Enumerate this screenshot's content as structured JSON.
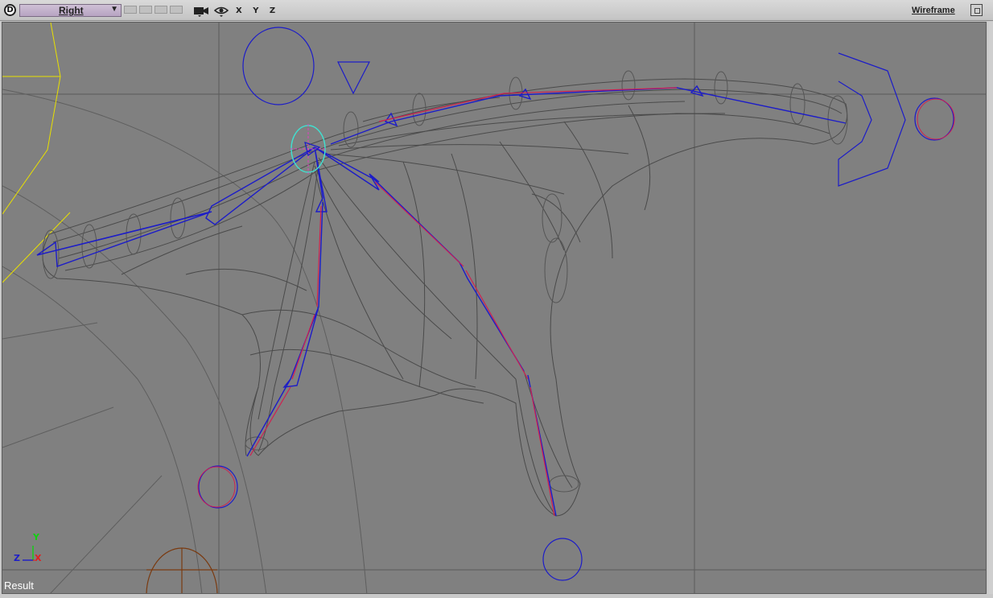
{
  "toolbar": {
    "logo": "D",
    "view_name": "Right",
    "axes": "X Y Z",
    "display_mode": "Wireframe"
  },
  "viewport": {
    "axis_y": "Y",
    "axis_z": "Z",
    "axis_x": "X",
    "status": "Result"
  },
  "colors": {
    "viewport_bg": "#808080",
    "bone": "#1c1cc8",
    "bone_highlight": "#d02050",
    "selected": "#40e0d0",
    "guide": "#e8e000",
    "mesh": "#505050"
  }
}
